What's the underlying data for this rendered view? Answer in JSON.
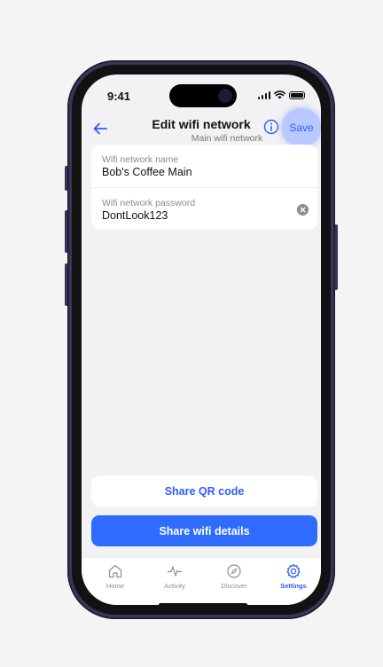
{
  "status_bar": {
    "time": "9:41"
  },
  "header": {
    "title": "Edit wifi network",
    "subtitle": "Main wifi network",
    "save_label": "Save"
  },
  "form": {
    "fields": [
      {
        "label": "Wifi network name",
        "value": "Bob's Coffee Main"
      },
      {
        "label": "Wifi network password",
        "value": "DontLook123"
      }
    ]
  },
  "actions": {
    "share_qr_label": "Share QR code",
    "share_details_label": "Share wifi details"
  },
  "tab_bar": {
    "active": "Settings",
    "items": [
      {
        "label": "Home",
        "icon": "home-icon"
      },
      {
        "label": "Activity",
        "icon": "activity-icon"
      },
      {
        "label": "Discover",
        "icon": "compass-icon"
      },
      {
        "label": "Settings",
        "icon": "gear-icon"
      }
    ]
  },
  "colors": {
    "accent": "#2f6bff",
    "accent_text": "#2f5cff",
    "background": "#f2f2f4",
    "device_frame": "#3a3458"
  }
}
